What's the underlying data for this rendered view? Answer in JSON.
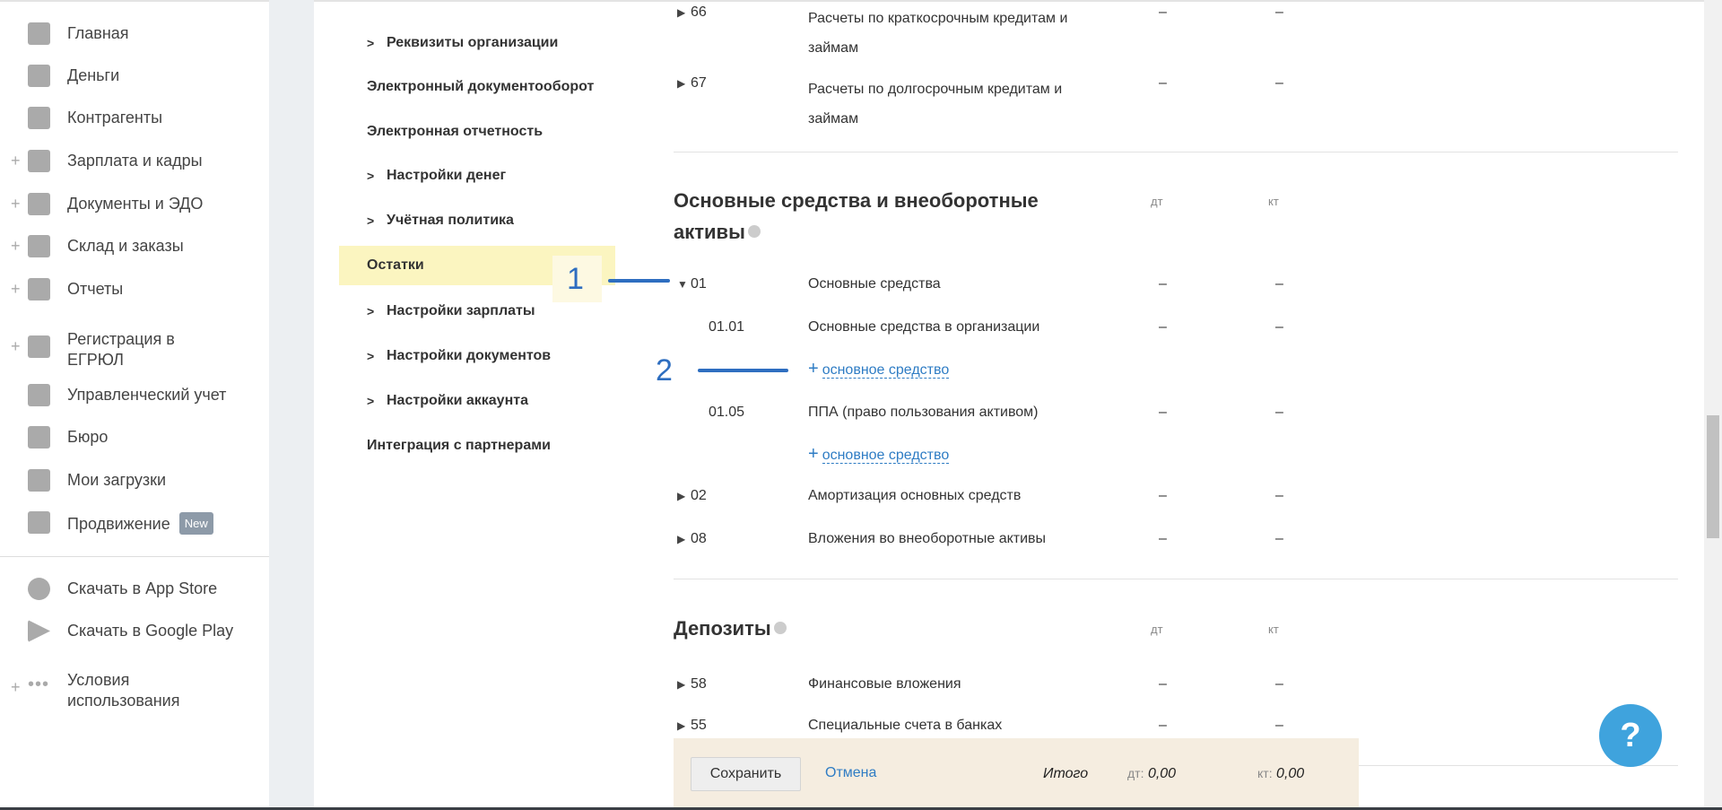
{
  "sidebar": {
    "items": [
      {
        "label": "Главная",
        "icon": "home-icon",
        "plus": false
      },
      {
        "label": "Деньги",
        "icon": "money-icon",
        "plus": false
      },
      {
        "label": "Контрагенты",
        "icon": "contractor-icon",
        "plus": false
      },
      {
        "label": "Зарплата и кадры",
        "icon": "wallet-icon",
        "plus": true
      },
      {
        "label": "Документы и ЭДО",
        "icon": "folder-icon",
        "plus": true
      },
      {
        "label": "Склад и заказы",
        "icon": "cart-icon",
        "plus": true
      },
      {
        "label": "Отчеты",
        "icon": "report-icon",
        "plus": true
      },
      {
        "label": "Регистрация в ЕГРЮЛ",
        "icon": "registration-icon",
        "plus": true
      },
      {
        "label": "Управленческий учет",
        "icon": "ruble-icon",
        "plus": false
      },
      {
        "label": "Бюро",
        "icon": "briefcase-icon",
        "plus": false
      },
      {
        "label": "Мои загрузки",
        "icon": "folder-icon",
        "plus": false
      },
      {
        "label": "Продвижение",
        "icon": "chart-icon",
        "plus": false,
        "badge": "New"
      },
      {
        "label": "Скачать в App Store",
        "icon": "apple-icon",
        "plus": false
      },
      {
        "label": "Скачать в Google Play",
        "icon": "google-play-icon",
        "plus": false
      },
      {
        "label": "Условия использования",
        "icon": "more-icon",
        "plus": true
      }
    ]
  },
  "settings": {
    "items": [
      {
        "label": "Реквизиты организации",
        "chevron": true
      },
      {
        "label": "Электронный документооборот",
        "chevron": false
      },
      {
        "label": "Электронная отчетность",
        "chevron": false
      },
      {
        "label": "Настройки денег",
        "chevron": true
      },
      {
        "label": "Учётная политика",
        "chevron": true
      },
      {
        "label": "Остатки",
        "chevron": false,
        "active": true
      },
      {
        "label": "Настройки зарплаты",
        "chevron": true
      },
      {
        "label": "Настройки документов",
        "chevron": true
      },
      {
        "label": "Настройки аккаунта",
        "chevron": true
      },
      {
        "label": "Интеграция с партнерами",
        "chevron": false
      }
    ]
  },
  "annotations": {
    "one": "1",
    "two": "2",
    "color": "#2e6ec0"
  },
  "top_rows": [
    {
      "code": "66",
      "name1": "Расчеты по краткосрочным кредитам и",
      "name2": "займам",
      "dt": "–",
      "kt": "–"
    },
    {
      "code": "67",
      "name1": "Расчеты по долгосрочным кредитам и",
      "name2": "займам",
      "dt": "–",
      "kt": "–"
    }
  ],
  "section1": {
    "title1": "Основные средства и внеоборотные",
    "title2": "активы",
    "dt": "дт",
    "kt": "кт",
    "rows": [
      {
        "code": "01",
        "name": "Основные средства",
        "dt": "–",
        "kt": "–",
        "expanded": true
      },
      {
        "code": "01.01",
        "name": "Основные средства в организации",
        "dt": "–",
        "kt": "–"
      },
      {
        "code": "01.05",
        "name": "ППА (право пользования активом)",
        "dt": "–",
        "kt": "–"
      },
      {
        "code": "02",
        "name": "Амортизация основных средств",
        "dt": "–",
        "kt": "–"
      },
      {
        "code": "08",
        "name": "Вложения во внеоборотные активы",
        "dt": "–",
        "kt": "–"
      }
    ],
    "add_plus": "+",
    "add_label": "основное средство"
  },
  "section2": {
    "title": "Депозиты",
    "dt": "дт",
    "kt": "кт",
    "rows": [
      {
        "code": "58",
        "name": "Финансовые вложения",
        "dt": "–",
        "kt": "–"
      },
      {
        "code": "55",
        "name": "Специальные счета в банках",
        "dt": "–",
        "kt": "–"
      }
    ]
  },
  "footer": {
    "save": "Сохранить",
    "cancel": "Отмена",
    "total": "Итого",
    "dt_label": "дт:",
    "dt_value": "0,00",
    "kt_label": "кт:",
    "kt_value": "0,00"
  },
  "help": "?",
  "colors": {
    "accent": "#2e7cc4",
    "active": "#fbf5c0",
    "footer": "#f5ede0",
    "help": "#3fa3dd"
  }
}
